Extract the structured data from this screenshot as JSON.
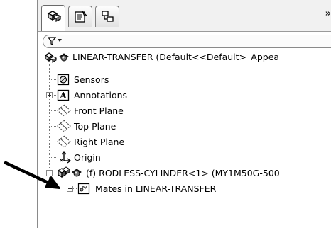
{
  "tabs": [
    {
      "icon": "feature-manager-icon",
      "active": true
    },
    {
      "icon": "property-manager-icon",
      "active": false
    },
    {
      "icon": "configuration-manager-icon",
      "active": false
    }
  ],
  "tab_overflow": "»",
  "filter": {
    "icon": "filter-icon"
  },
  "tree": {
    "root": {
      "label": "LINEAR-TRANSFER  (Default<<Default>_Appea"
    },
    "items": [
      {
        "label": "Sensors",
        "icon": "sensors-icon"
      },
      {
        "label": "Annotations",
        "icon": "annotations-icon"
      },
      {
        "label": "Front Plane",
        "icon": "plane-icon"
      },
      {
        "label": "Top Plane",
        "icon": "plane-icon"
      },
      {
        "label": "Right Plane",
        "icon": "plane-icon"
      },
      {
        "label": "Origin",
        "icon": "origin-icon"
      },
      {
        "label": "(f) RODLESS-CYLINDER<1> (MY1M50G-500",
        "icon": "subassembly-icon"
      },
      {
        "label": "Mates in LINEAR-TRANSFER",
        "icon": "mates-icon"
      }
    ]
  },
  "annotation_arrow": {
    "icon": "pointer-arrow-icon"
  }
}
